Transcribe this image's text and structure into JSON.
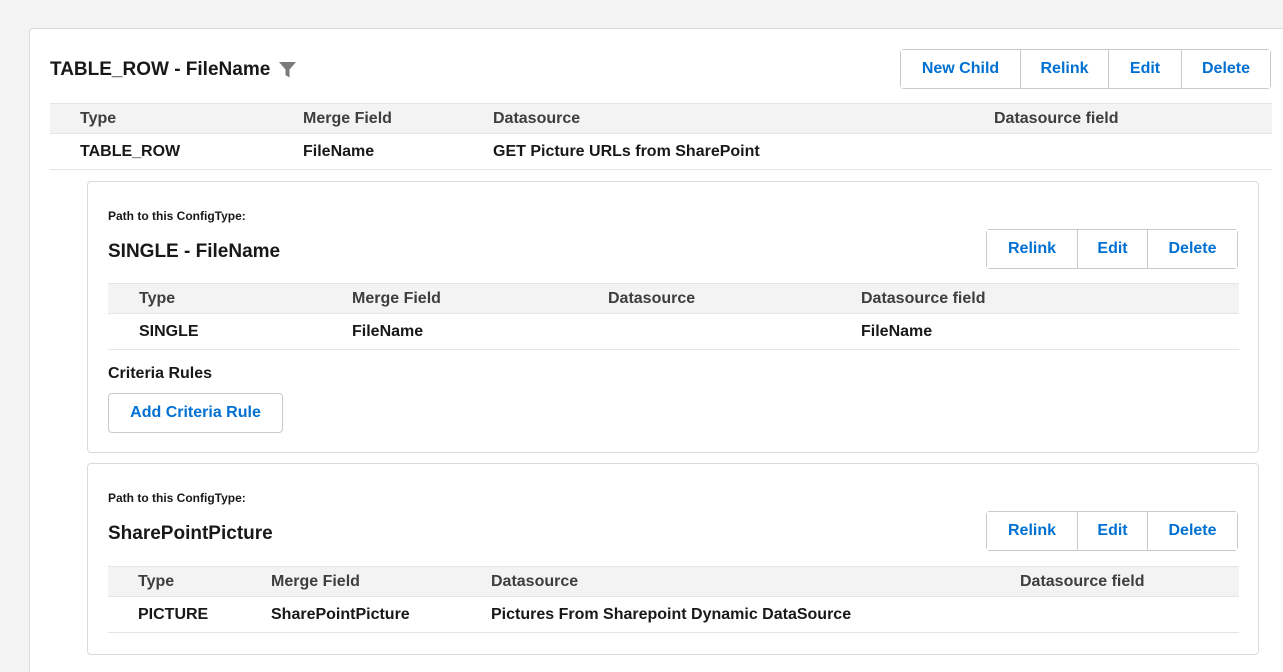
{
  "main": {
    "title": "TABLE_ROW - FileName",
    "buttons": {
      "new_child": "New Child",
      "relink": "Relink",
      "edit": "Edit",
      "delete": "Delete"
    },
    "table": {
      "headers": [
        "Type",
        "Merge Field",
        "Datasource",
        "Datasource field"
      ],
      "row": [
        "TABLE_ROW",
        "FileName",
        "GET Picture URLs from SharePoint",
        ""
      ]
    }
  },
  "sub_cards": [
    {
      "path_label": "Path to this ConfigType:",
      "title": "SINGLE - FileName",
      "buttons": {
        "relink": "Relink",
        "edit": "Edit",
        "delete": "Delete"
      },
      "table": {
        "headers": [
          "Type",
          "Merge Field",
          "Datasource",
          "Datasource field"
        ],
        "row": [
          "SINGLE",
          "FileName",
          "",
          "FileName"
        ]
      },
      "criteria_label": "Criteria Rules",
      "add_criteria_label": "Add Criteria Rule"
    },
    {
      "path_label": "Path to this ConfigType:",
      "title": "SharePointPicture",
      "buttons": {
        "relink": "Relink",
        "edit": "Edit",
        "delete": "Delete"
      },
      "table": {
        "headers": [
          "Type",
          "Merge Field",
          "Datasource",
          "Datasource field"
        ],
        "row": [
          "PICTURE",
          "SharePointPicture",
          "Pictures From Sharepoint Dynamic DataSource",
          ""
        ]
      }
    }
  ],
  "icons": {
    "filter": "filter-funnel-icon"
  },
  "colors": {
    "link": "#0070d2",
    "header_bg": "#f3f3f3",
    "border": "#c9c9c9"
  }
}
